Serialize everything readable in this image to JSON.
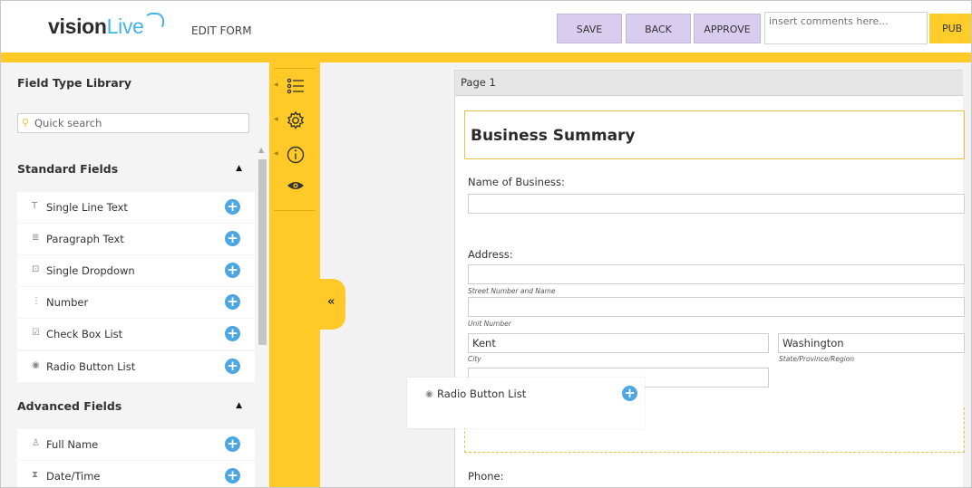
{
  "header": {
    "logo_part1": "vision",
    "logo_part2": "Live",
    "page_title": "EDIT FORM",
    "save_label": "SAVE",
    "back_label": "BACK",
    "approve_label": "APPROVE",
    "comments_placeholder": "insert comments here...",
    "publish_label": "PUB"
  },
  "sidebar": {
    "title": "Field Type Library",
    "search_placeholder": "Quick search",
    "standard_title": "Standard Fields",
    "standard_items": [
      {
        "icon": "T",
        "label": "Single Line Text"
      },
      {
        "icon": "≣",
        "label": "Paragraph Text"
      },
      {
        "icon": "⊡",
        "label": "Single Dropdown"
      },
      {
        "icon": "⋮",
        "label": "Number"
      },
      {
        "icon": "☑",
        "label": "Check Box List"
      },
      {
        "icon": "◉",
        "label": "Radio Button List"
      }
    ],
    "advanced_title": "Advanced Fields",
    "advanced_items": [
      {
        "icon": "♙",
        "label": "Full Name"
      },
      {
        "icon": "⧗",
        "label": "Date/Time"
      }
    ]
  },
  "tools": {
    "icons": [
      "list-icon",
      "settings-icon",
      "info-icon",
      "preview-eye-icon"
    ],
    "collapse_label": "«"
  },
  "form": {
    "page_label": "Page 1",
    "section_title": "Business Summary",
    "name_label": "Name of Business:",
    "address_label": "Address:",
    "street_sub": "Street Number and Name",
    "unit_sub": "Unit Number",
    "city_value": "Kent",
    "city_sub": "City",
    "state_value": "Washington",
    "state_sub": "State/Province/Region",
    "phone_label": "Phone:"
  },
  "drag_ghost": {
    "icon": "◉",
    "label": "Radio Button List"
  },
  "colors": {
    "accent_yellow": "#ffc927",
    "button_purple": "#d9cdef",
    "add_blue": "#4ba6e2",
    "logo_blue": "#44b6e6"
  }
}
